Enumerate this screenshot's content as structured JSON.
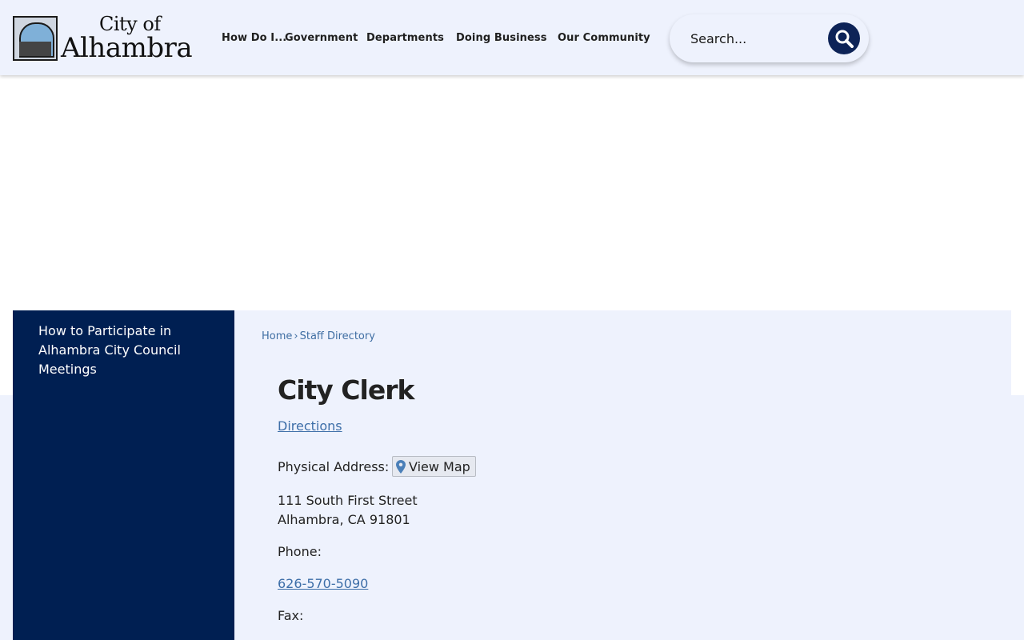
{
  "logo": {
    "line1": "City of",
    "line2": "Alhambra"
  },
  "nav": {
    "items": [
      {
        "label": "How Do I..."
      },
      {
        "label": "Government"
      },
      {
        "label": "Departments"
      },
      {
        "label": "Doing Business"
      },
      {
        "label": "Our Community"
      }
    ]
  },
  "search": {
    "placeholder": "Search..."
  },
  "sidebar": {
    "items": [
      {
        "label": "How to Participate in Alhambra City Council Meetings"
      }
    ]
  },
  "breadcrumb": {
    "home": "Home",
    "separator": "›",
    "current": "Staff Directory"
  },
  "contact": {
    "title": "City Clerk",
    "directions": "Directions",
    "physical_address_label": "Physical Address:",
    "view_map": "View Map",
    "address_line1": "111 South First Street",
    "address_line2": "Alhambra, CA 91801",
    "phone_label": "Phone:",
    "phone": "626-570-5090",
    "fax_label": "Fax:"
  },
  "colors": {
    "header_bg": "#eef2fd",
    "sidebar_bg": "#001f52",
    "search_button": "#0d2357",
    "link": "#3d6ea8"
  },
  "icons": {
    "search": "magnifier-icon",
    "map": "map-pin-icon"
  }
}
